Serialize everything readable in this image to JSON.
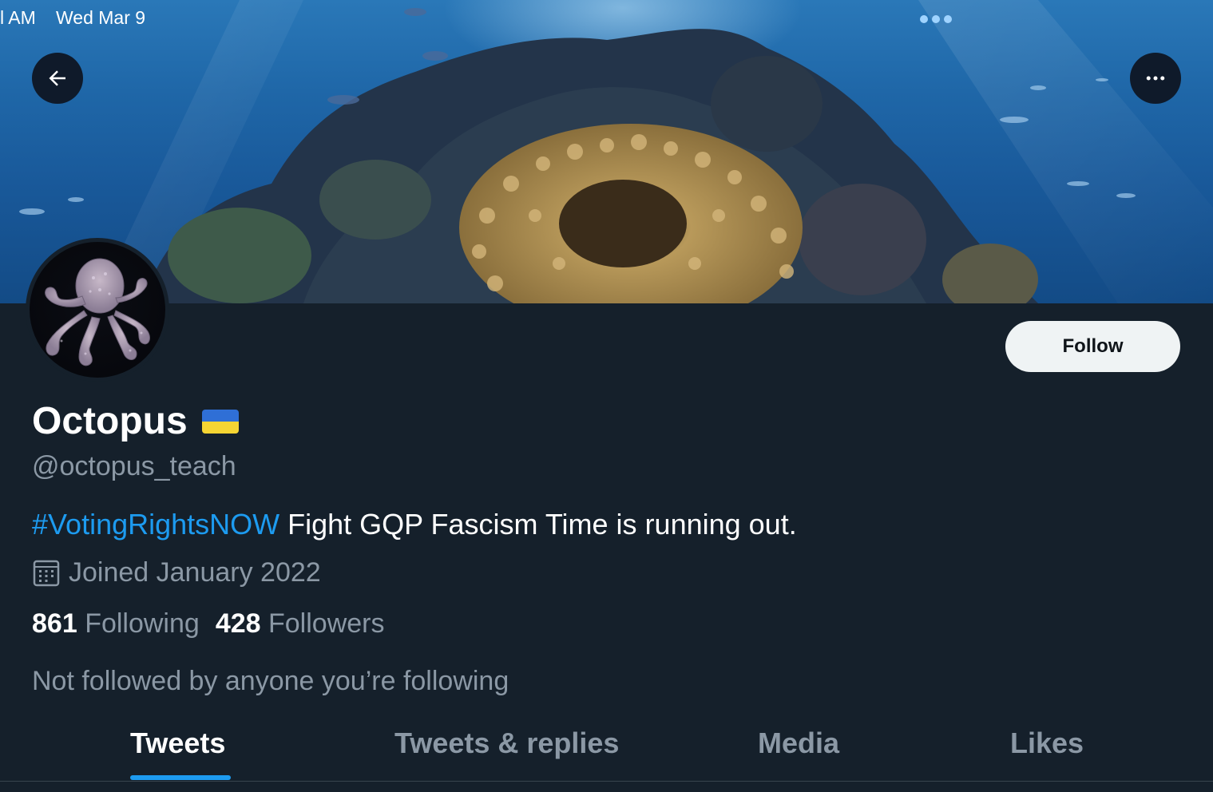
{
  "status_bar": {
    "time": "l AM",
    "date": "Wed Mar 9"
  },
  "profile": {
    "display_name": "Octopus",
    "handle": "@octopus_teach",
    "bio_hashtag": "#VotingRightsNOW",
    "bio_text": " Fight GQP Fascism Time is running out.",
    "joined": "Joined January 2022",
    "following_count": "861",
    "following_label": "Following",
    "followers_count": "428",
    "followers_label": "Followers",
    "not_followed_text": "Not followed by anyone you’re following"
  },
  "actions": {
    "follow_label": "Follow"
  },
  "tabs": [
    {
      "label": "Tweets",
      "active": true
    },
    {
      "label": "Tweets & replies",
      "active": false
    },
    {
      "label": "Media",
      "active": false
    },
    {
      "label": "Likes",
      "active": false
    }
  ],
  "icons": {
    "back": "arrow-left-icon",
    "more": "more-horizontal-icon",
    "calendar": "calendar-icon",
    "flag": "ukraine-flag-icon"
  },
  "colors": {
    "background": "#15202b",
    "accent": "#1d9bf0",
    "secondary_text": "#8b98a5",
    "follow_button_bg": "#eff3f4",
    "flag_blue": "#2f6fd6",
    "flag_yellow": "#f5d533"
  }
}
